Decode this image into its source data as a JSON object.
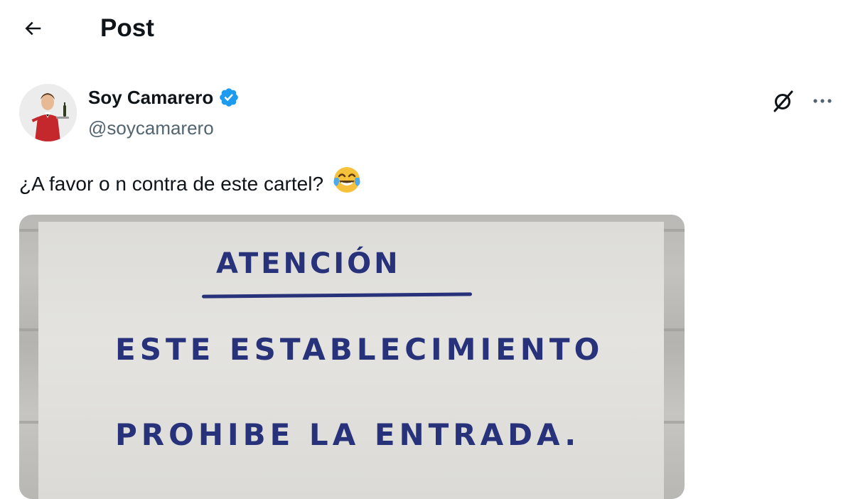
{
  "header": {
    "title": "Post"
  },
  "author": {
    "name": "Soy Camarero",
    "handle": "@soycamarero",
    "verified_color": "#1d9bf0"
  },
  "post": {
    "text": "¿A favor o n contra de este cartel?",
    "emoji": "😂"
  },
  "media": {
    "sign_title": "ATENCIÓN",
    "sign_line_1": "ESTE ESTABLECIMIENTO",
    "sign_line_2": "PROHIBE LA ENTRADA."
  },
  "icons": {
    "back": "arrow-left-icon",
    "verified": "verified-badge-icon",
    "grok": "grok-icon",
    "more": "more-icon"
  }
}
